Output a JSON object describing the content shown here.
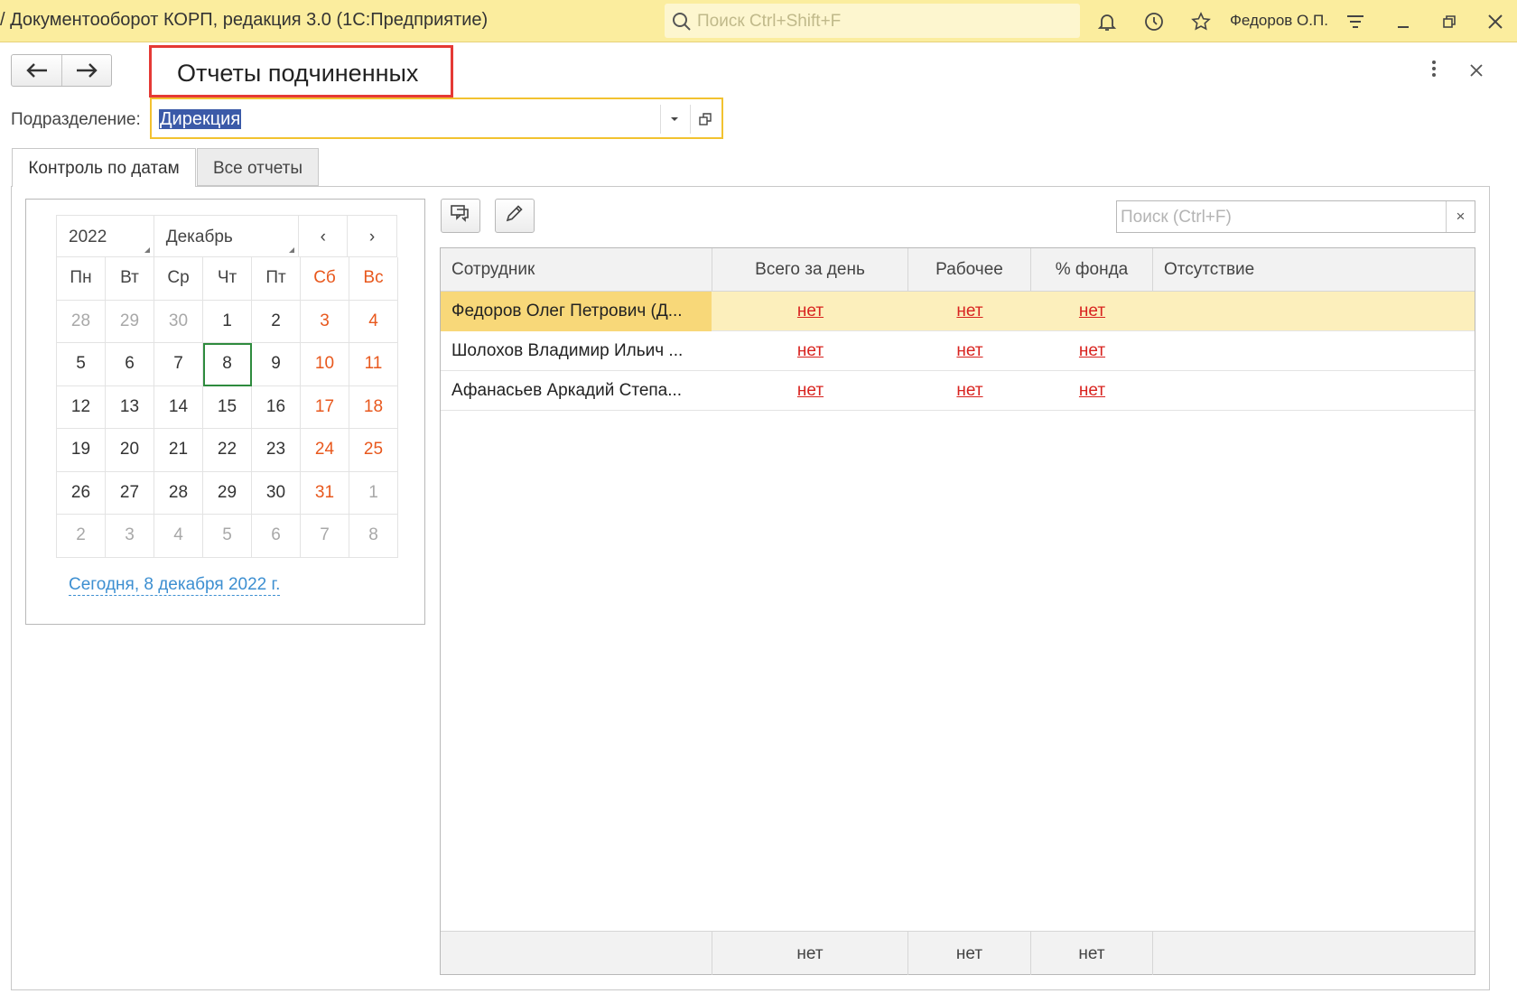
{
  "window": {
    "app_title": "/ Документооборот КОРП, редакция 3.0  (1С:Предприятие)",
    "search_placeholder": "Поиск Ctrl+Shift+F",
    "user_name": "Федоров О.П."
  },
  "form": {
    "title": "Отчеты подчиненных",
    "department_label": "Подразделение:",
    "department_value": "Дирекция"
  },
  "tabs": [
    {
      "label": "Контроль по датам",
      "active": true
    },
    {
      "label": "Все отчеты",
      "active": false
    }
  ],
  "calendar": {
    "year": "2022",
    "month": "Декабрь",
    "prev": "‹",
    "next": "›",
    "weekdays": [
      "Пн",
      "Вт",
      "Ср",
      "Чт",
      "Пт",
      "Сб",
      "Вс"
    ],
    "weeks": [
      [
        "28",
        "29",
        "30",
        "1",
        "2",
        "3",
        "4"
      ],
      [
        "5",
        "6",
        "7",
        "8",
        "9",
        "10",
        "11"
      ],
      [
        "12",
        "13",
        "14",
        "15",
        "16",
        "17",
        "18"
      ],
      [
        "19",
        "20",
        "21",
        "22",
        "23",
        "24",
        "25"
      ],
      [
        "26",
        "27",
        "28",
        "29",
        "30",
        "31",
        "1"
      ],
      [
        "2",
        "3",
        "4",
        "5",
        "6",
        "7",
        "8"
      ]
    ],
    "selected_day": "8",
    "today_link": "Сегодня, 8 декабря 2022 г."
  },
  "table": {
    "search_placeholder": "Поиск (Ctrl+F)",
    "clear": "×",
    "columns": [
      "Сотрудник",
      "Всего за день",
      "Рабочее",
      "% фонда",
      "Отсутствие"
    ],
    "rows": [
      {
        "name": "Федоров Олег Петрович (Д...",
        "total": "нет",
        "work": "нет",
        "fund": "нет",
        "absence": ""
      },
      {
        "name": "Шолохов Владимир Ильич ...",
        "total": "нет",
        "work": "нет",
        "fund": "нет",
        "absence": ""
      },
      {
        "name": "Афанасьев Аркадий Степа...",
        "total": "нет",
        "work": "нет",
        "fund": "нет",
        "absence": ""
      }
    ],
    "footer": {
      "total": "нет",
      "work": "нет",
      "fund": "нет"
    }
  },
  "colors": {
    "titlebar": "#fbed9e",
    "selection": "#fcefbc",
    "weekend": "#e8581d",
    "link": "#d8231f"
  }
}
